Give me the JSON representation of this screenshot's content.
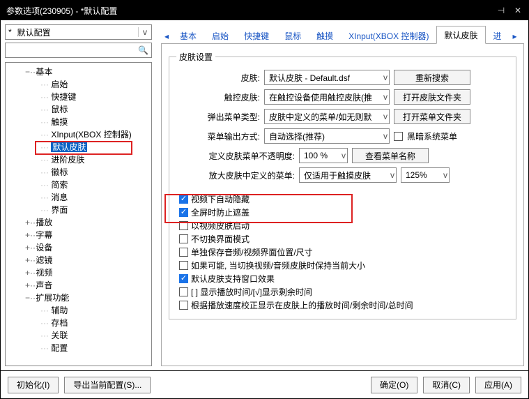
{
  "window": {
    "title": "参数选项(230905) - *默认配置"
  },
  "filter": {
    "value": "默认配置",
    "marker": "v"
  },
  "search": {
    "placeholder": ""
  },
  "tree": {
    "items": [
      {
        "label": "基本",
        "level": 1,
        "toggle": "−"
      },
      {
        "label": "启始",
        "level": 2
      },
      {
        "label": "快捷键",
        "level": 2
      },
      {
        "label": "鼠标",
        "level": 2
      },
      {
        "label": "触摸",
        "level": 2
      },
      {
        "label": "XInput(XBOX 控制器)",
        "level": 2
      },
      {
        "label": "默认皮肤",
        "level": 2,
        "selected": true
      },
      {
        "label": "进阶皮肤",
        "level": 2
      },
      {
        "label": "徽标",
        "level": 2
      },
      {
        "label": "简索",
        "level": 2
      },
      {
        "label": "消息",
        "level": 2
      },
      {
        "label": "界面",
        "level": 2
      },
      {
        "label": "播放",
        "level": 1,
        "toggle": "+"
      },
      {
        "label": "字幕",
        "level": 1,
        "toggle": "+"
      },
      {
        "label": "设备",
        "level": 1,
        "toggle": "+"
      },
      {
        "label": "滤镜",
        "level": 1,
        "toggle": "+"
      },
      {
        "label": "视频",
        "level": 1,
        "toggle": "+"
      },
      {
        "label": "声音",
        "level": 1,
        "toggle": "+"
      },
      {
        "label": "扩展功能",
        "level": 1,
        "toggle": "−"
      },
      {
        "label": "辅助",
        "level": 2
      },
      {
        "label": "存档",
        "level": 2
      },
      {
        "label": "关联",
        "level": 2
      },
      {
        "label": "配置",
        "level": 2
      }
    ]
  },
  "tabs": {
    "items": [
      {
        "label": "基本"
      },
      {
        "label": "启始"
      },
      {
        "label": "快捷键"
      },
      {
        "label": "鼠标"
      },
      {
        "label": "触摸"
      },
      {
        "label": "XInput(XBOX 控制器)"
      },
      {
        "label": "默认皮肤",
        "active": true
      },
      {
        "label": "进"
      }
    ],
    "scroll_left": "◂",
    "scroll_right": "▸"
  },
  "panel": {
    "legend": "皮肤设置",
    "rows": {
      "skin": {
        "label": "皮肤:",
        "value": "默认皮肤 - Default.dsf",
        "btn": "重新搜索"
      },
      "touchskin": {
        "label": "触控皮肤:",
        "value": "在触控设备使用触控皮肤(推",
        "btn": "打开皮肤文件夹"
      },
      "popup": {
        "label": "弹出菜单类型:",
        "value": "皮肤中定义的菜单/如无则默",
        "btn": "打开菜单文件夹"
      },
      "output": {
        "label": "菜单输出方式:",
        "value": "自动选择(推荐)",
        "chk": "黑暗系统菜单",
        "checked": false
      },
      "opacity": {
        "label": "定义皮肤菜单不透明度:",
        "value": "100 %",
        "btn": "查看菜单名称"
      },
      "zoom": {
        "label": "放大皮肤中定义的菜单:",
        "value": "仅适用于触摸皮肤",
        "pct": "125%"
      }
    },
    "checks": [
      {
        "label": "视频下自动隐藏",
        "checked": true
      },
      {
        "label": "全屏时防止遮盖",
        "checked": true
      },
      {
        "label": "以视频皮肤启动",
        "checked": false
      },
      {
        "label": "不切换界面模式",
        "checked": false
      },
      {
        "label": "单独保存音频/视频界面位置/尺寸",
        "checked": false
      },
      {
        "label": "如果可能, 当切换视频/音频皮肤时保持当前大小",
        "checked": false
      },
      {
        "label": "默认皮肤支持窗口效果",
        "checked": true
      },
      {
        "label": "[ ] 显示播放时间/[√]显示剩余时间",
        "checked": false
      },
      {
        "label": "根据播放速度校正显示在皮肤上的播放时间/剩余时间/总时间",
        "checked": false
      }
    ]
  },
  "footer": {
    "init": "初始化(I)",
    "export": "导出当前配置(S)...",
    "ok": "确定(O)",
    "cancel": "取消(C)",
    "apply": "应用(A)"
  }
}
